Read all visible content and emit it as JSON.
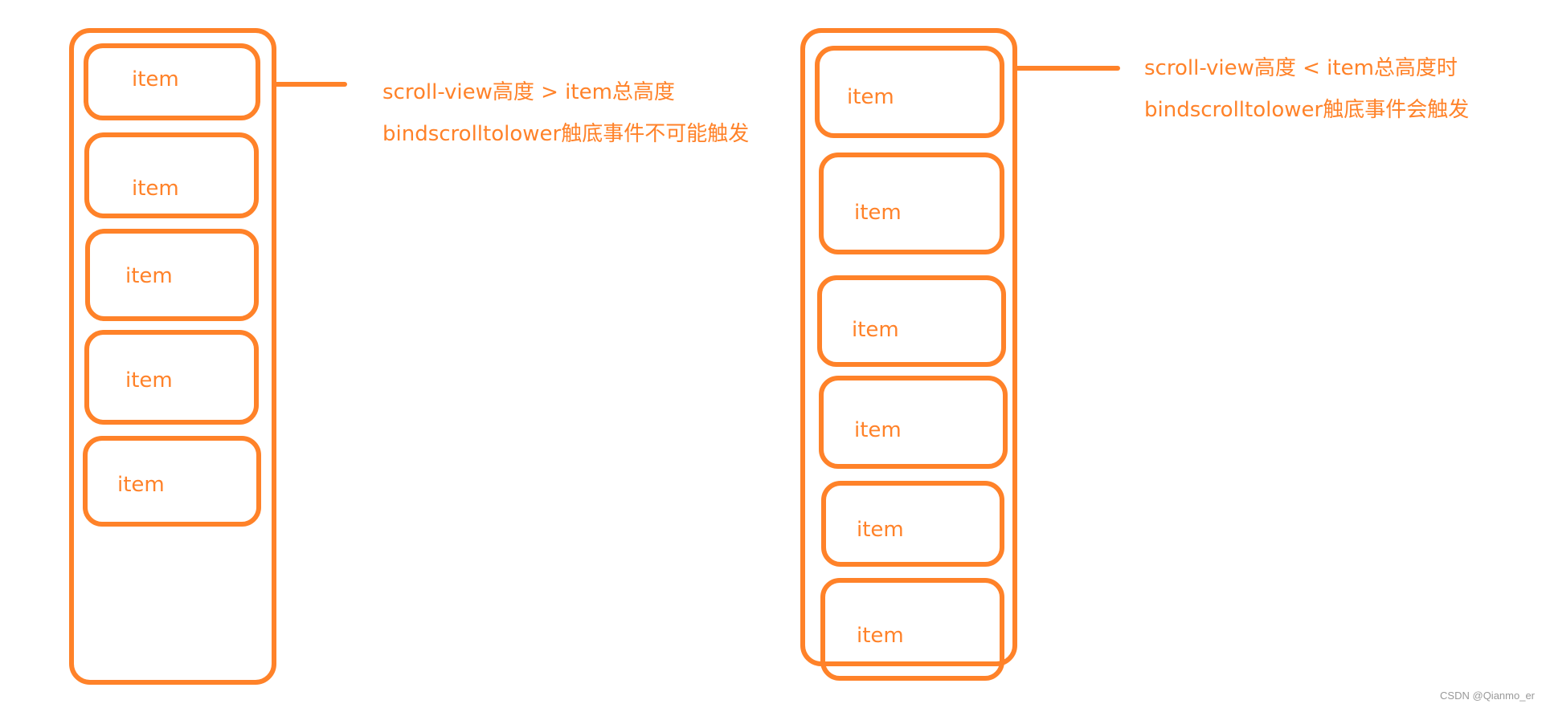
{
  "accent_color": "#ff8229",
  "left_diagram": {
    "title_line_1": "scroll-view高度 > item总高度",
    "title_line_2": "bindscrolltolower触底事件不可能触发",
    "items": [
      "item",
      "item",
      "item",
      "item",
      "item"
    ]
  },
  "right_diagram": {
    "title_line_1": "scroll-view高度 < item总高度时",
    "title_line_2": "bindscrolltolower触底事件会触发",
    "items": [
      "item",
      "item",
      "item",
      "item",
      "item",
      "item"
    ]
  },
  "watermark": "CSDN @Qianmo_er"
}
